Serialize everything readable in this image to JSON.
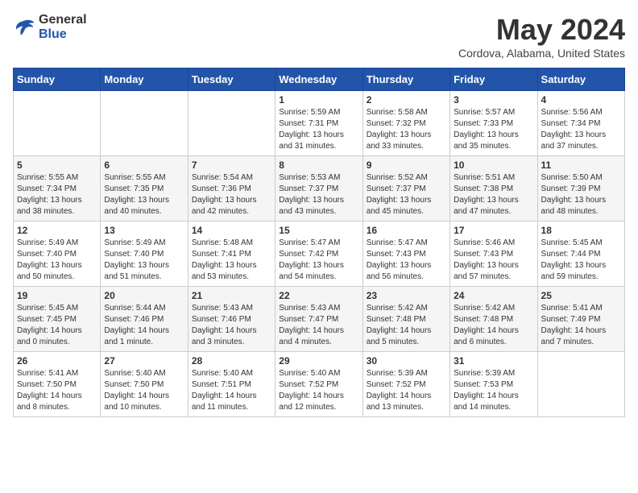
{
  "header": {
    "logo_general": "General",
    "logo_blue": "Blue",
    "month_title": "May 2024",
    "location": "Cordova, Alabama, United States"
  },
  "days_of_week": [
    "Sunday",
    "Monday",
    "Tuesday",
    "Wednesday",
    "Thursday",
    "Friday",
    "Saturday"
  ],
  "weeks": [
    [
      {
        "day": "",
        "info": ""
      },
      {
        "day": "",
        "info": ""
      },
      {
        "day": "",
        "info": ""
      },
      {
        "day": "1",
        "info": "Sunrise: 5:59 AM\nSunset: 7:31 PM\nDaylight: 13 hours\nand 31 minutes."
      },
      {
        "day": "2",
        "info": "Sunrise: 5:58 AM\nSunset: 7:32 PM\nDaylight: 13 hours\nand 33 minutes."
      },
      {
        "day": "3",
        "info": "Sunrise: 5:57 AM\nSunset: 7:33 PM\nDaylight: 13 hours\nand 35 minutes."
      },
      {
        "day": "4",
        "info": "Sunrise: 5:56 AM\nSunset: 7:34 PM\nDaylight: 13 hours\nand 37 minutes."
      }
    ],
    [
      {
        "day": "5",
        "info": "Sunrise: 5:55 AM\nSunset: 7:34 PM\nDaylight: 13 hours\nand 38 minutes."
      },
      {
        "day": "6",
        "info": "Sunrise: 5:55 AM\nSunset: 7:35 PM\nDaylight: 13 hours\nand 40 minutes."
      },
      {
        "day": "7",
        "info": "Sunrise: 5:54 AM\nSunset: 7:36 PM\nDaylight: 13 hours\nand 42 minutes."
      },
      {
        "day": "8",
        "info": "Sunrise: 5:53 AM\nSunset: 7:37 PM\nDaylight: 13 hours\nand 43 minutes."
      },
      {
        "day": "9",
        "info": "Sunrise: 5:52 AM\nSunset: 7:37 PM\nDaylight: 13 hours\nand 45 minutes."
      },
      {
        "day": "10",
        "info": "Sunrise: 5:51 AM\nSunset: 7:38 PM\nDaylight: 13 hours\nand 47 minutes."
      },
      {
        "day": "11",
        "info": "Sunrise: 5:50 AM\nSunset: 7:39 PM\nDaylight: 13 hours\nand 48 minutes."
      }
    ],
    [
      {
        "day": "12",
        "info": "Sunrise: 5:49 AM\nSunset: 7:40 PM\nDaylight: 13 hours\nand 50 minutes."
      },
      {
        "day": "13",
        "info": "Sunrise: 5:49 AM\nSunset: 7:40 PM\nDaylight: 13 hours\nand 51 minutes."
      },
      {
        "day": "14",
        "info": "Sunrise: 5:48 AM\nSunset: 7:41 PM\nDaylight: 13 hours\nand 53 minutes."
      },
      {
        "day": "15",
        "info": "Sunrise: 5:47 AM\nSunset: 7:42 PM\nDaylight: 13 hours\nand 54 minutes."
      },
      {
        "day": "16",
        "info": "Sunrise: 5:47 AM\nSunset: 7:43 PM\nDaylight: 13 hours\nand 56 minutes."
      },
      {
        "day": "17",
        "info": "Sunrise: 5:46 AM\nSunset: 7:43 PM\nDaylight: 13 hours\nand 57 minutes."
      },
      {
        "day": "18",
        "info": "Sunrise: 5:45 AM\nSunset: 7:44 PM\nDaylight: 13 hours\nand 59 minutes."
      }
    ],
    [
      {
        "day": "19",
        "info": "Sunrise: 5:45 AM\nSunset: 7:45 PM\nDaylight: 14 hours\nand 0 minutes."
      },
      {
        "day": "20",
        "info": "Sunrise: 5:44 AM\nSunset: 7:46 PM\nDaylight: 14 hours\nand 1 minute."
      },
      {
        "day": "21",
        "info": "Sunrise: 5:43 AM\nSunset: 7:46 PM\nDaylight: 14 hours\nand 3 minutes."
      },
      {
        "day": "22",
        "info": "Sunrise: 5:43 AM\nSunset: 7:47 PM\nDaylight: 14 hours\nand 4 minutes."
      },
      {
        "day": "23",
        "info": "Sunrise: 5:42 AM\nSunset: 7:48 PM\nDaylight: 14 hours\nand 5 minutes."
      },
      {
        "day": "24",
        "info": "Sunrise: 5:42 AM\nSunset: 7:48 PM\nDaylight: 14 hours\nand 6 minutes."
      },
      {
        "day": "25",
        "info": "Sunrise: 5:41 AM\nSunset: 7:49 PM\nDaylight: 14 hours\nand 7 minutes."
      }
    ],
    [
      {
        "day": "26",
        "info": "Sunrise: 5:41 AM\nSunset: 7:50 PM\nDaylight: 14 hours\nand 8 minutes."
      },
      {
        "day": "27",
        "info": "Sunrise: 5:40 AM\nSunset: 7:50 PM\nDaylight: 14 hours\nand 10 minutes."
      },
      {
        "day": "28",
        "info": "Sunrise: 5:40 AM\nSunset: 7:51 PM\nDaylight: 14 hours\nand 11 minutes."
      },
      {
        "day": "29",
        "info": "Sunrise: 5:40 AM\nSunset: 7:52 PM\nDaylight: 14 hours\nand 12 minutes."
      },
      {
        "day": "30",
        "info": "Sunrise: 5:39 AM\nSunset: 7:52 PM\nDaylight: 14 hours\nand 13 minutes."
      },
      {
        "day": "31",
        "info": "Sunrise: 5:39 AM\nSunset: 7:53 PM\nDaylight: 14 hours\nand 14 minutes."
      },
      {
        "day": "",
        "info": ""
      }
    ]
  ]
}
